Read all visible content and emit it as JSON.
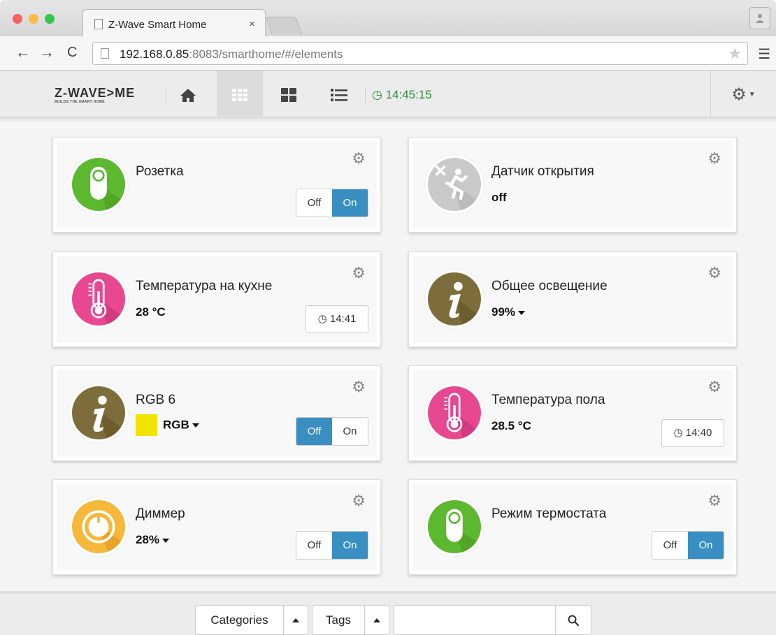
{
  "browser": {
    "tab_title": "Z-Wave Smart Home",
    "tab_close": "×",
    "url_host": "192.168.0.85",
    "url_rest": ":8083/smarthome/#/elements",
    "traffic_colors": [
      "#fc605c",
      "#fdbc40",
      "#34c84a"
    ]
  },
  "header": {
    "logo": "Z-WAVE>ME",
    "logo_tagline": "BUILDS THE SMART HOME",
    "nav": [
      "home-icon",
      "grid-icon",
      "dashboard-icon",
      "list-icon"
    ],
    "clock": "14:45:15"
  },
  "cards": [
    {
      "title": "Розетка",
      "value": "",
      "icon": "switch-icon",
      "toggle": {
        "off": "Off",
        "on": "On",
        "state": "on"
      }
    },
    {
      "title": "Датчик открытия",
      "value": "off",
      "icon": "door-sensor-icon"
    },
    {
      "title": "Температура на кухне",
      "value": "28 °C",
      "icon": "thermometer-icon",
      "time": "14:41"
    },
    {
      "title": "Общее освещение",
      "value": "99%",
      "icon": "info-icon",
      "dropdown": true
    },
    {
      "title": "RGB 6",
      "value": "RGB",
      "icon": "info-icon",
      "swatch": "#f0e400",
      "dropdown": true,
      "toggle": {
        "off": "Off",
        "on": "On",
        "state": "off"
      }
    },
    {
      "title": "Температура пола",
      "value": "28.5 °C",
      "icon": "thermometer-icon",
      "time": "14:40"
    },
    {
      "title": "Диммер",
      "value": "28%",
      "icon": "dimmer-icon",
      "dropdown": true,
      "toggle": {
        "off": "Off",
        "on": "On",
        "state": "on"
      }
    },
    {
      "title": "Режим термостата",
      "value": "",
      "icon": "switch-icon",
      "toggle": {
        "off": "Off",
        "on": "On",
        "state": "on"
      }
    }
  ],
  "footer": {
    "categories": "Categories",
    "tags": "Tags",
    "search_placeholder": ""
  },
  "colors": {
    "accent": "#3a8fc2",
    "clock": "#2e8b3d",
    "switch_green": "#5cb82f",
    "thermo_pink": "#e8488f",
    "info_olive": "#7d6d3a",
    "dimmer_yellow": "#f6b83a"
  }
}
